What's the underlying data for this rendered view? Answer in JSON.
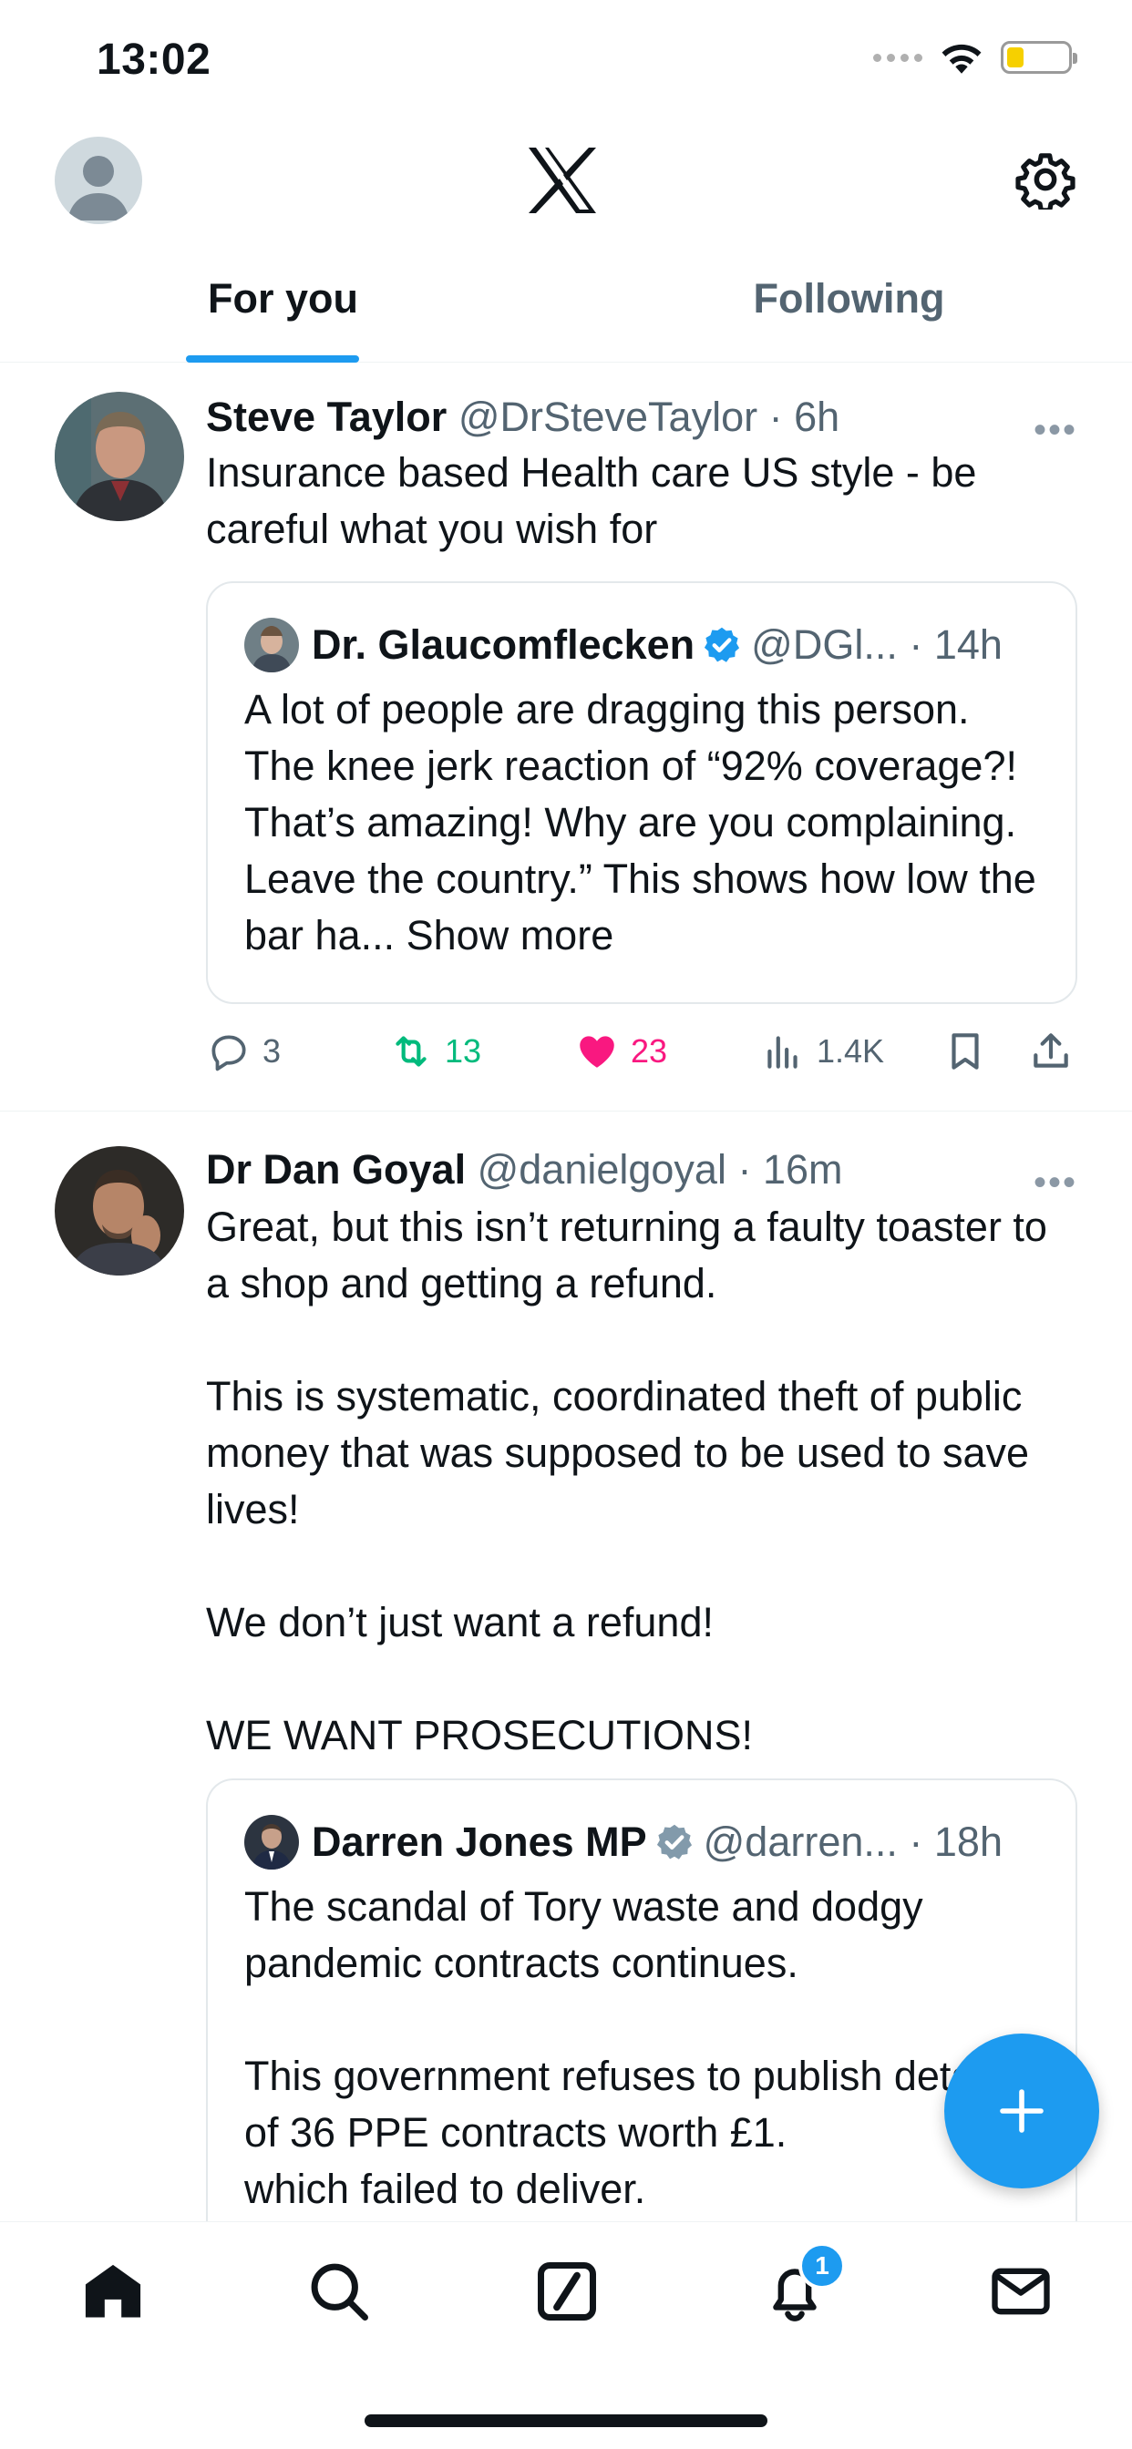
{
  "status_bar": {
    "time": "13:02"
  },
  "header": {
    "logo": "x-logo-icon",
    "settings_icon": "gear-icon",
    "avatar_icon": "default-avatar-icon"
  },
  "tabs": [
    {
      "label": "For you",
      "active": true
    },
    {
      "label": "Following",
      "active": false
    }
  ],
  "tweets": [
    {
      "name": "Steve Taylor",
      "handle": "@DrSteveTaylor",
      "time": "6h",
      "text": "Insurance based Health care US style - be careful what you wish for",
      "quote": {
        "name": "Dr. Glaucomflecken",
        "verified_color": "#1d9bf0",
        "handle": "@DGl...",
        "time": "14h",
        "text": "A lot of people are dragging this person. The knee jerk reaction of “92% coverage?! That’s amazing! Why are you complaining. Leave the country.” This shows how low the bar ha...",
        "show_more": "Show more"
      },
      "actions": {
        "replies": "3",
        "reposts": "13",
        "likes": "23",
        "views": "1.4K"
      }
    },
    {
      "name": "Dr Dan Goyal",
      "handle": "@danielgoyal",
      "time": "16m",
      "text": "Great, but this isn’t returning a faulty toaster to a shop and getting a refund.\n\nThis is systematic, coordinated theft of public money that was supposed to be used to save lives!\n\nWe don’t just want a refund!\n\nWE WANT PROSECUTIONS!",
      "quote": {
        "name": "Darren Jones MP",
        "verified_color": "#829aab",
        "handle": "@darren...",
        "time": "18h",
        "text": "The scandal of Tory waste and dodgy pandemic contracts continues.\n\nThis government refuses to publish details of 36 PPE contracts worth £1.\nwhich failed to deliver."
      }
    }
  ],
  "bottom_nav": {
    "items": [
      "home-icon",
      "search-icon",
      "grok-icon",
      "notifications-icon",
      "messages-icon"
    ],
    "notifications_count": "1"
  },
  "colors": {
    "accent": "#1d9bf0",
    "repost": "#00ba7c",
    "like": "#f91880",
    "secondary_text": "#536471"
  }
}
